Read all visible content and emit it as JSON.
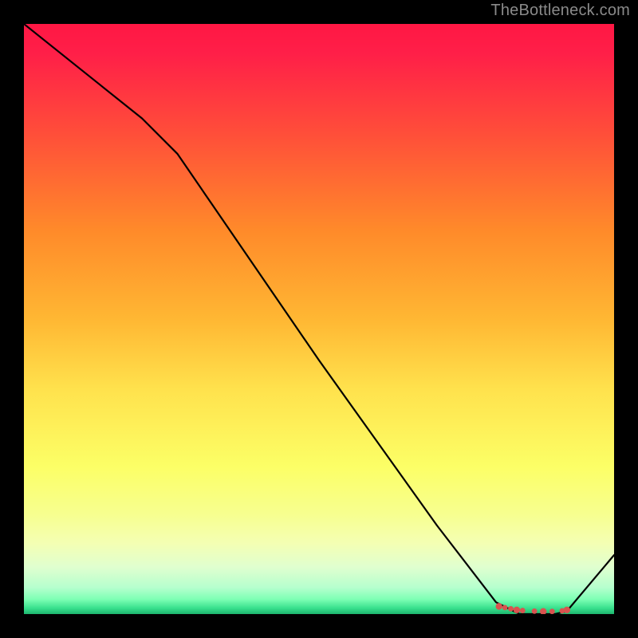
{
  "attribution": "TheBottleneck.com",
  "chart_data": {
    "type": "line",
    "title": "",
    "xlabel": "",
    "ylabel": "",
    "xlim": [
      0,
      100
    ],
    "ylim": [
      0,
      100
    ],
    "x": [
      0,
      10,
      20,
      26,
      50,
      70,
      80,
      84,
      90,
      92,
      100
    ],
    "y": [
      100,
      92,
      84,
      78,
      43,
      15,
      2,
      0,
      0,
      0.5,
      10
    ],
    "dotted_region_x": [
      80.5,
      81.5,
      82.5,
      83.5,
      84.5,
      86.5,
      88,
      89.5,
      91.2,
      92
    ],
    "dotted_region_y": [
      1.3,
      1.1,
      0.9,
      0.7,
      0.6,
      0.5,
      0.45,
      0.45,
      0.55,
      0.7
    ],
    "dot_color": "#d9534f",
    "line_color": "#000000",
    "line_width": 2.2,
    "gradient_stops": [
      {
        "offset": 0.0,
        "color": "#ff1744"
      },
      {
        "offset": 0.05,
        "color": "#ff1f48"
      },
      {
        "offset": 0.18,
        "color": "#ff4c3a"
      },
      {
        "offset": 0.35,
        "color": "#ff8a2a"
      },
      {
        "offset": 0.5,
        "color": "#ffb733"
      },
      {
        "offset": 0.62,
        "color": "#ffe24d"
      },
      {
        "offset": 0.75,
        "color": "#fcff66"
      },
      {
        "offset": 0.83,
        "color": "#f7ff8f"
      },
      {
        "offset": 0.88,
        "color": "#f4ffb3"
      },
      {
        "offset": 0.92,
        "color": "#e0ffcf"
      },
      {
        "offset": 0.955,
        "color": "#b6ffce"
      },
      {
        "offset": 0.975,
        "color": "#7dffb4"
      },
      {
        "offset": 0.99,
        "color": "#38e08d"
      },
      {
        "offset": 1.0,
        "color": "#1db56e"
      }
    ]
  }
}
